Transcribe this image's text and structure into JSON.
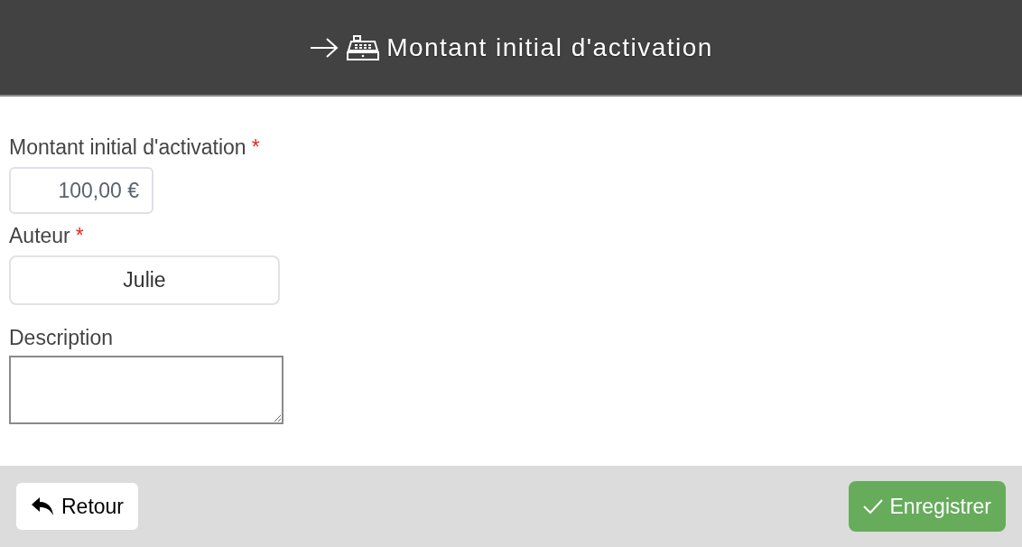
{
  "header": {
    "title": "Montant initial d'activation"
  },
  "fields": [
    {
      "kind": "amount",
      "label": "Montant initial d'activation",
      "required_mark": "*",
      "value": "100,00 €"
    },
    {
      "kind": "select",
      "label": "Auteur",
      "required_mark": "*",
      "value": "Julie"
    },
    {
      "kind": "textarea",
      "label": "Description"
    }
  ],
  "footer": {
    "back_button": "Retour",
    "save_button": "Enregistrer"
  }
}
